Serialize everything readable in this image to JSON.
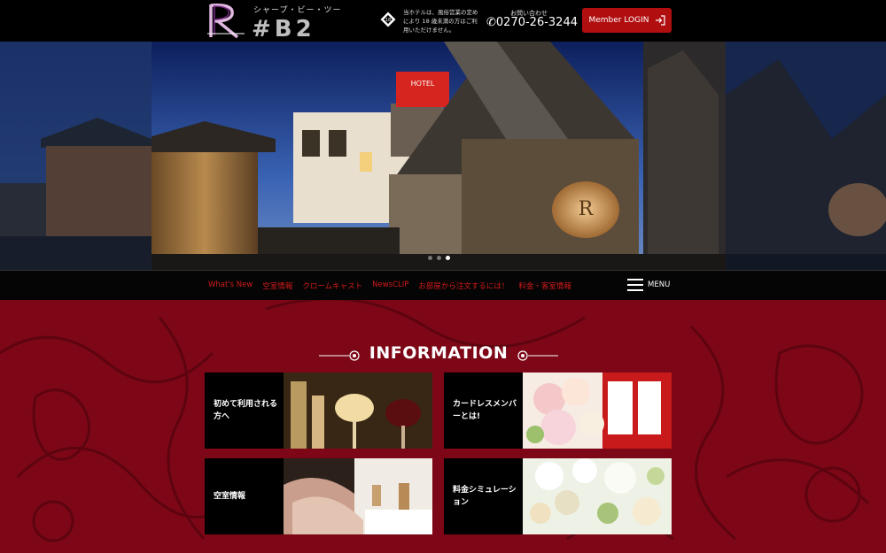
{
  "header": {
    "logo_kana": "シャープ・ビー・ツー",
    "logo_text": "#B2",
    "notice": "当ホテルは、風俗営業の定めにより 18 歳未満の方はご利用いただけません。",
    "contact_label": "お問い合わせ",
    "phone": "0270-26-3244",
    "member_login": "Member LOGIN"
  },
  "hero": {
    "sign_text": "HOTEL",
    "slides": 3,
    "active_slide": 3
  },
  "nav": {
    "links": [
      "What's New",
      "空室情報",
      "クロームキャスト",
      "NewsCLIP",
      "お部屋から注文するには！",
      "料金・客室情報"
    ],
    "menu_label": "MENU"
  },
  "info": {
    "title": "INFORMATION",
    "cards": [
      {
        "label": "初めて利用される方へ"
      },
      {
        "label": "カードレスメンバーとは!"
      },
      {
        "label": "空室情報"
      },
      {
        "label": "料金シミュレーション"
      }
    ]
  },
  "colors": {
    "accent_red": "#b10e10",
    "nav_link": "#d21a1a",
    "background_red": "#7d0716"
  }
}
